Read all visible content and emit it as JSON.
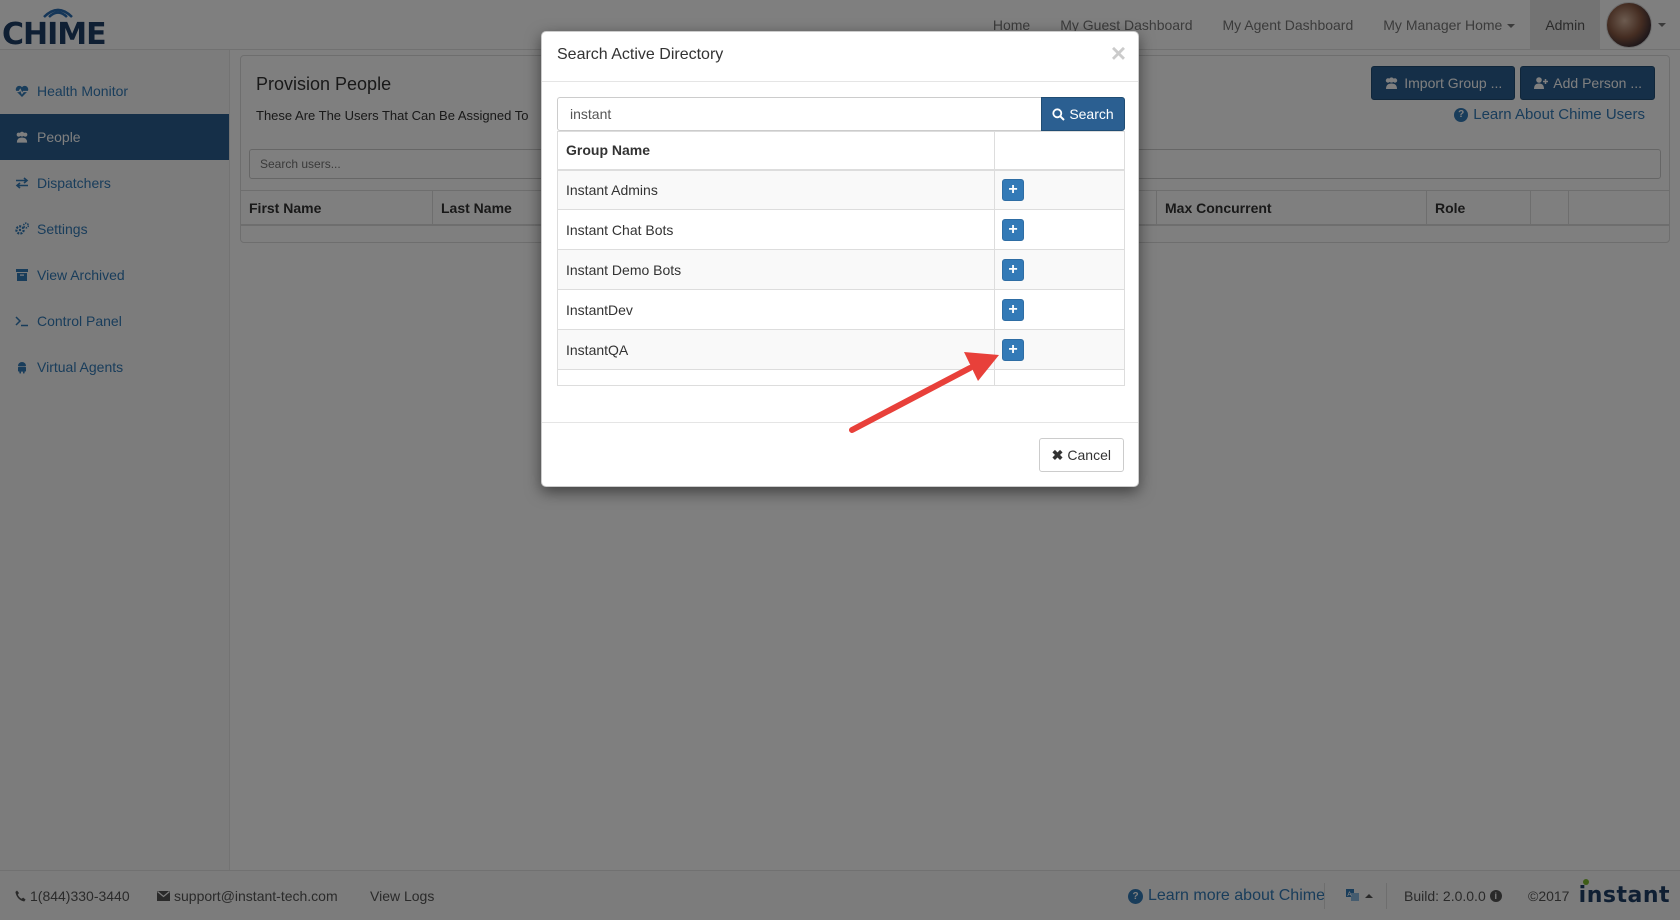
{
  "nav": {
    "logo_text": "CHIME",
    "links": [
      "Home",
      "My Guest Dashboard",
      "My Agent Dashboard",
      "My Manager Home",
      "Admin"
    ]
  },
  "sidebar": {
    "items": [
      {
        "label": "Health Monitor",
        "icon": "heartbeat-icon"
      },
      {
        "label": "People",
        "icon": "users-icon"
      },
      {
        "label": "Dispatchers",
        "icon": "exchange-icon"
      },
      {
        "label": "Settings",
        "icon": "cogs-icon"
      },
      {
        "label": "View Archived",
        "icon": "archive-icon"
      },
      {
        "label": "Control Panel",
        "icon": "terminal-icon"
      },
      {
        "label": "Virtual Agents",
        "icon": "android-icon"
      }
    ]
  },
  "main": {
    "title": "Provision People",
    "subtitle": "These Are The Users That Can Be Assigned To",
    "import_group_label": "Import Group ...",
    "add_person_label": "Add Person ...",
    "learn_users_label": "Learn About Chime Users",
    "search_placeholder": "Search users...",
    "columns": [
      "First Name",
      "Last Name",
      "",
      "",
      "",
      "Max Concurrent",
      "Role",
      "",
      ""
    ]
  },
  "modal": {
    "title": "Search Active Directory",
    "close_glyph": "×",
    "search_value": "instant",
    "search_button": "Search",
    "table_header": "Group Name",
    "groups": [
      "Instant Admins",
      "Instant Chat Bots",
      "Instant Demo Bots",
      "InstantDev",
      "InstantQA"
    ],
    "add_glyph": "+",
    "cancel_label": "Cancel",
    "cancel_glyph": "✖"
  },
  "footer": {
    "phone": "1(844)330-3440",
    "email": "support@instant-tech.com",
    "view_logs": "View Logs",
    "learn_more": "Learn more about Chime",
    "build": "Build: 2.0.0.0",
    "copyright": "©2017",
    "brand": "instant"
  },
  "colors": {
    "primary": "#2b5f91",
    "link": "#337ab7",
    "annotation_arrow": "#e8403a",
    "brand_green": "#7dbb2f"
  }
}
